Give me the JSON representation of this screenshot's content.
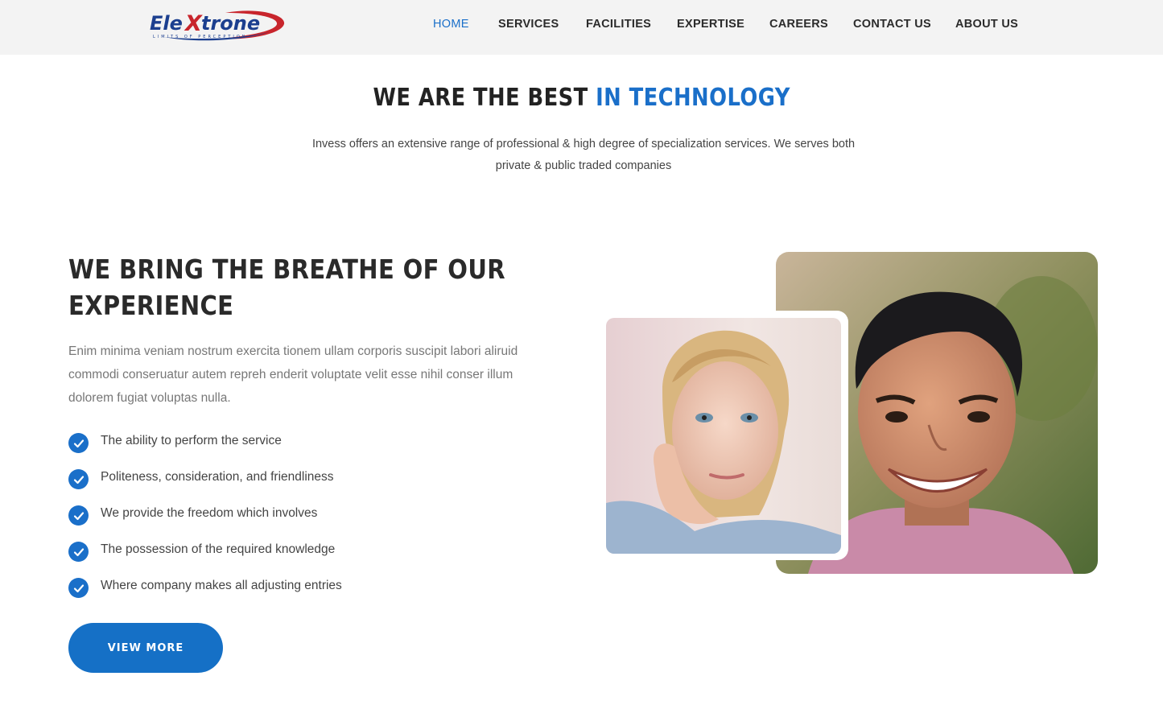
{
  "header": {
    "logo_text": "ElexTrone",
    "logo_tagline": "LIMITS OF PERCEPTION",
    "nav": [
      {
        "label": "HOME",
        "active": true
      },
      {
        "label": "SERVICES",
        "active": false
      },
      {
        "label": "FACILITIES",
        "active": false
      },
      {
        "label": "EXPERTISE",
        "active": false
      },
      {
        "label": "CAREERS",
        "active": false
      },
      {
        "label": "CONTACT US",
        "active": false
      },
      {
        "label": "ABOUT US",
        "active": false
      }
    ]
  },
  "intro": {
    "title_main": "WE ARE THE BEST ",
    "title_accent": "IN TECHNOLOGY",
    "text": "Invess offers an extensive range of professional & high degree of specialization services. We serves both private & public traded companies"
  },
  "experience": {
    "title": "WE BRING THE BREATHE OF OUR EXPERIENCE",
    "text": "Enim minima veniam nostrum exercita tionem ullam corporis suscipit labori aliruid commodi conseruatur autem repreh enderit voluptate velit esse nihil conser illum dolorem fugiat voluptas nulla.",
    "features": [
      "The ability to perform the service",
      "Politeness, consideration, and friendliness",
      "We provide the freedom which involves",
      "The possession of the required knowledge",
      "Where company makes all adjusting entries"
    ],
    "button_label": "VIEW MORE",
    "check_icon": "check-circle-icon"
  },
  "colors": {
    "accent": "#1a6fc9",
    "header_bg": "#f3f3f3",
    "heading": "#2a2a2a",
    "button": "#1570c6"
  }
}
